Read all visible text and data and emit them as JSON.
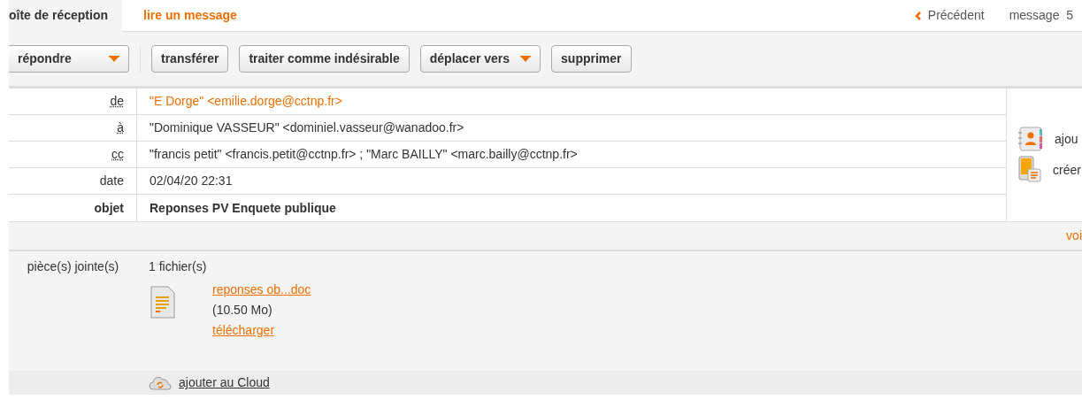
{
  "breadcrumb": [
    {
      "label": "oîte de réception",
      "selected": false
    },
    {
      "label": "lire un message",
      "selected": true
    }
  ],
  "nav": {
    "previous": "Précédent",
    "counter": "message  5"
  },
  "toolbar": [
    {
      "label": "répondre",
      "dropdown": true
    },
    {
      "label": "transférer",
      "dropdown": false
    },
    {
      "label": "traiter comme indésirable",
      "dropdown": false
    },
    {
      "label": "déplacer vers",
      "dropdown": true
    },
    {
      "label": "supprimer",
      "dropdown": false
    }
  ],
  "headers": [
    {
      "label": "de",
      "value": "\"E Dorge\" <emilie.dorge@cctnp.fr>",
      "kind": "sender"
    },
    {
      "label": "à",
      "value": "\"Dominique VASSEUR\" <dominiel.vasseur@wanadoo.fr>",
      "kind": "abbr"
    },
    {
      "label": "cc",
      "value": "\"francis petit\" <francis.petit@cctnp.fr> ;  \"Marc BAILLY\" <marc.bailly@cctnp.fr>",
      "kind": "abbr"
    },
    {
      "label": "date",
      "value": "02/04/20 22:31",
      "kind": "plain"
    },
    {
      "label": "objet",
      "value": "Reponses PV Enquete publique",
      "kind": "subject"
    }
  ],
  "side_actions": [
    {
      "label": "ajou",
      "kind": "contacts"
    },
    {
      "label": "créer",
      "kind": "card"
    }
  ],
  "view_link": "voi",
  "attachments": {
    "label": "pièce(s) jointe(s)",
    "count": "1 fichier(s)",
    "files": [
      {
        "name": "reponses ob...doc",
        "size": "(10.50 Mo)",
        "download": "télécharger"
      }
    ],
    "cloud": "ajouter au Cloud"
  }
}
